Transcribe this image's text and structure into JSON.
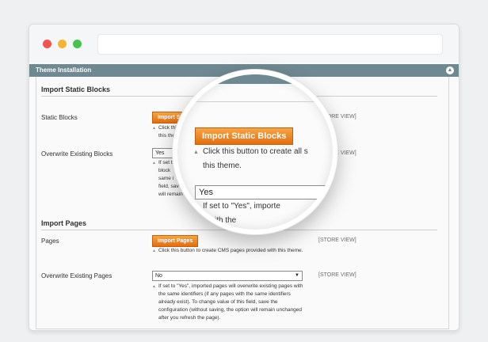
{
  "window": {
    "section_title": "Theme Installation",
    "collapse_icon": "collapse-arrow-icon"
  },
  "static_blocks": {
    "group_title": "Import Static Blocks",
    "label": "Static Blocks",
    "button_label": "Import Static Blocks",
    "button_label_clipped": "Import St",
    "note_clipped": [
      "Click thi",
      "this them"
    ],
    "scope": "[STORE VIEW]"
  },
  "overwrite_blocks": {
    "label": "Overwrite Existing Blocks",
    "value": "Yes",
    "note_clipped": [
      "If set t",
      "block",
      "same i",
      "field, sav",
      "will remain"
    ],
    "scope": "[STORE VIEW]"
  },
  "pages": {
    "group_title": "Import Pages",
    "label": "Pages",
    "button_label": "Import Pages",
    "note": "Click this button to create CMS pages provided with this theme.",
    "scope": "[STORE VIEW]"
  },
  "overwrite_pages": {
    "label": "Overwrite Existing Pages",
    "value": "No",
    "note": "If set to \"Yes\", imported pages will overwrite existing pages with the same identifiers (if any pages with the same identifiers already exist). To change value of this field, save the configuration (without saving, the option will remain unchanged after you refresh the page).",
    "scope": "[STORE VIEW]"
  },
  "magnifier": {
    "button_label": "Import Static Blocks",
    "note_line1": "Click this button to create all s",
    "note_line2": "this theme.",
    "select_value": "Yes",
    "note2_line1": "If set to \"Yes\", importe",
    "note2_line2": "s with the"
  }
}
